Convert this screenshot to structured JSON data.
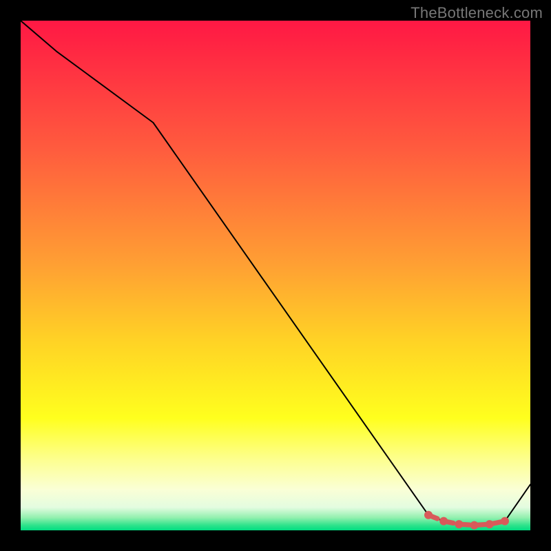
{
  "header": {
    "watermark": "TheBottleneck.com"
  },
  "chart_data": {
    "type": "line",
    "title": "",
    "xlabel": "",
    "ylabel": "",
    "xlim": [
      0,
      100
    ],
    "ylim": [
      0,
      100
    ],
    "grid": false,
    "background_gradient": {
      "stops": [
        {
          "offset": 0.0,
          "color": "#ff1844"
        },
        {
          "offset": 0.25,
          "color": "#ff5b3e"
        },
        {
          "offset": 0.48,
          "color": "#ffa033"
        },
        {
          "offset": 0.63,
          "color": "#ffd325"
        },
        {
          "offset": 0.78,
          "color": "#ffff1e"
        },
        {
          "offset": 0.86,
          "color": "#fdff8e"
        },
        {
          "offset": 0.92,
          "color": "#faffd6"
        },
        {
          "offset": 0.955,
          "color": "#e3fce0"
        },
        {
          "offset": 0.975,
          "color": "#93f0af"
        },
        {
          "offset": 0.99,
          "color": "#2fe38b"
        },
        {
          "offset": 1.0,
          "color": "#00dd82"
        }
      ]
    },
    "series": [
      {
        "name": "bottleneck-curve",
        "color": "#000000",
        "stroke_width": 2,
        "x": [
          0,
          7,
          26,
          80,
          83,
          86,
          89,
          92,
          95,
          100
        ],
        "values": [
          100,
          94,
          80,
          3,
          1.8,
          1.2,
          1.0,
          1.2,
          1.8,
          9
        ]
      }
    ],
    "markers": {
      "name": "optimal-zone",
      "shape": "rounded-dot",
      "color": "#d85a5a",
      "radius": 6,
      "x": [
        80,
        83,
        86,
        89,
        92,
        95
      ],
      "values": [
        3.0,
        1.8,
        1.2,
        1.0,
        1.2,
        1.8
      ]
    }
  }
}
